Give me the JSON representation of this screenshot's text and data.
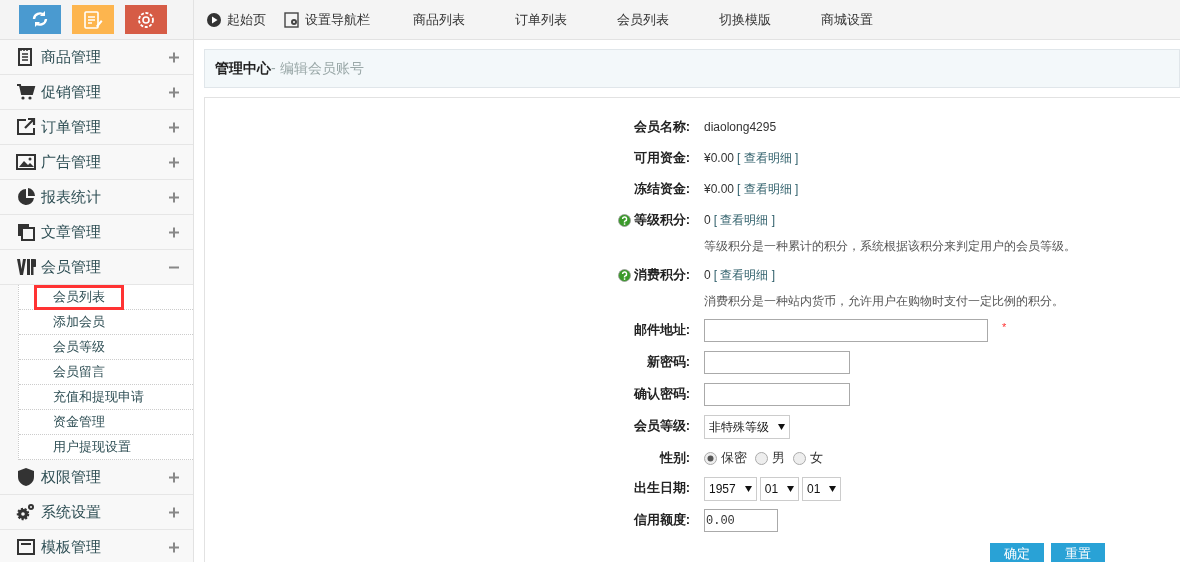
{
  "toolbar_buttons": [
    {
      "kind": "refresh"
    },
    {
      "kind": "edit"
    },
    {
      "kind": "settings"
    }
  ],
  "top_nav": [
    {
      "label": "起始页",
      "kind": "play"
    },
    {
      "label": "设置导航栏",
      "kind": "gear"
    },
    {
      "label": "商品列表"
    },
    {
      "label": "订单列表"
    },
    {
      "label": "会员列表"
    },
    {
      "label": "切换模版"
    },
    {
      "label": "商城设置"
    }
  ],
  "sidebar": {
    "items": [
      {
        "label": "商品管理",
        "kind": "notepad",
        "expanded": false
      },
      {
        "label": "促销管理",
        "kind": "cart",
        "expanded": false
      },
      {
        "label": "订单管理",
        "kind": "share",
        "expanded": false
      },
      {
        "label": "广告管理",
        "kind": "picture",
        "expanded": false
      },
      {
        "label": "报表统计",
        "kind": "pie",
        "expanded": false
      },
      {
        "label": "文章管理",
        "kind": "copy",
        "expanded": false
      },
      {
        "label": "会员管理",
        "kind": "vip",
        "expanded": true,
        "children": [
          {
            "label": "会员列表",
            "selected": true
          },
          {
            "label": "添加会员",
            "selected": false
          },
          {
            "label": "会员等级",
            "selected": false
          },
          {
            "label": "会员留言",
            "selected": false
          },
          {
            "label": "充值和提现申请",
            "selected": false
          },
          {
            "label": "资金管理",
            "selected": false
          },
          {
            "label": "用户提现设置",
            "selected": false
          }
        ]
      },
      {
        "label": "权限管理",
        "kind": "shield",
        "expanded": false
      },
      {
        "label": "系统设置",
        "kind": "gears",
        "expanded": false
      },
      {
        "label": "模板管理",
        "kind": "monitor",
        "expanded": false
      }
    ]
  },
  "breadcrumb": {
    "title": "管理中心",
    "subtitle": "- 编辑会员账号"
  },
  "form": {
    "fields": [
      {
        "kind": "text",
        "label": "会员名称:",
        "value": "diaolong4295"
      },
      {
        "kind": "text",
        "label": "可用资金:",
        "value": "¥0.00",
        "link": "[ 查看明细 ]"
      },
      {
        "kind": "text",
        "label": "冻结资金:",
        "value": "¥0.00",
        "link": "[ 查看明细 ]"
      },
      {
        "kind": "text",
        "label": "等级积分:",
        "value": "0",
        "link": "[ 查看明细 ]",
        "help": true,
        "note": "等级积分是一种累计的积分，系统根据该积分来判定用户的会员等级。"
      },
      {
        "kind": "text",
        "label": "消费积分:",
        "value": "0",
        "link": "[ 查看明细 ]",
        "help": true,
        "note": "消费积分是一种站内货币，允许用户在购物时支付一定比例的积分。"
      },
      {
        "kind": "wide_input",
        "label": "邮件地址:",
        "required_mark": "*"
      },
      {
        "kind": "input",
        "label": "新密码:"
      },
      {
        "kind": "input",
        "label": "确认密码:"
      },
      {
        "kind": "select",
        "label": "会员等级:",
        "options": [
          {
            "label": "非特殊等级"
          }
        ]
      },
      {
        "kind": "radio",
        "label": "性别:",
        "options": [
          {
            "label": "保密",
            "selected": true
          },
          {
            "label": "男",
            "selected": false
          },
          {
            "label": "女",
            "selected": false
          }
        ]
      },
      {
        "kind": "select",
        "label": "出生日期:",
        "options": [
          {
            "label": "1957"
          },
          {
            "label": "01"
          },
          {
            "label": "01"
          }
        ]
      },
      {
        "kind": "short_input",
        "label": "信用额度:",
        "value": "0.00"
      }
    ],
    "buttons": [
      {
        "label": "确定"
      },
      {
        "label": "重置"
      }
    ]
  }
}
